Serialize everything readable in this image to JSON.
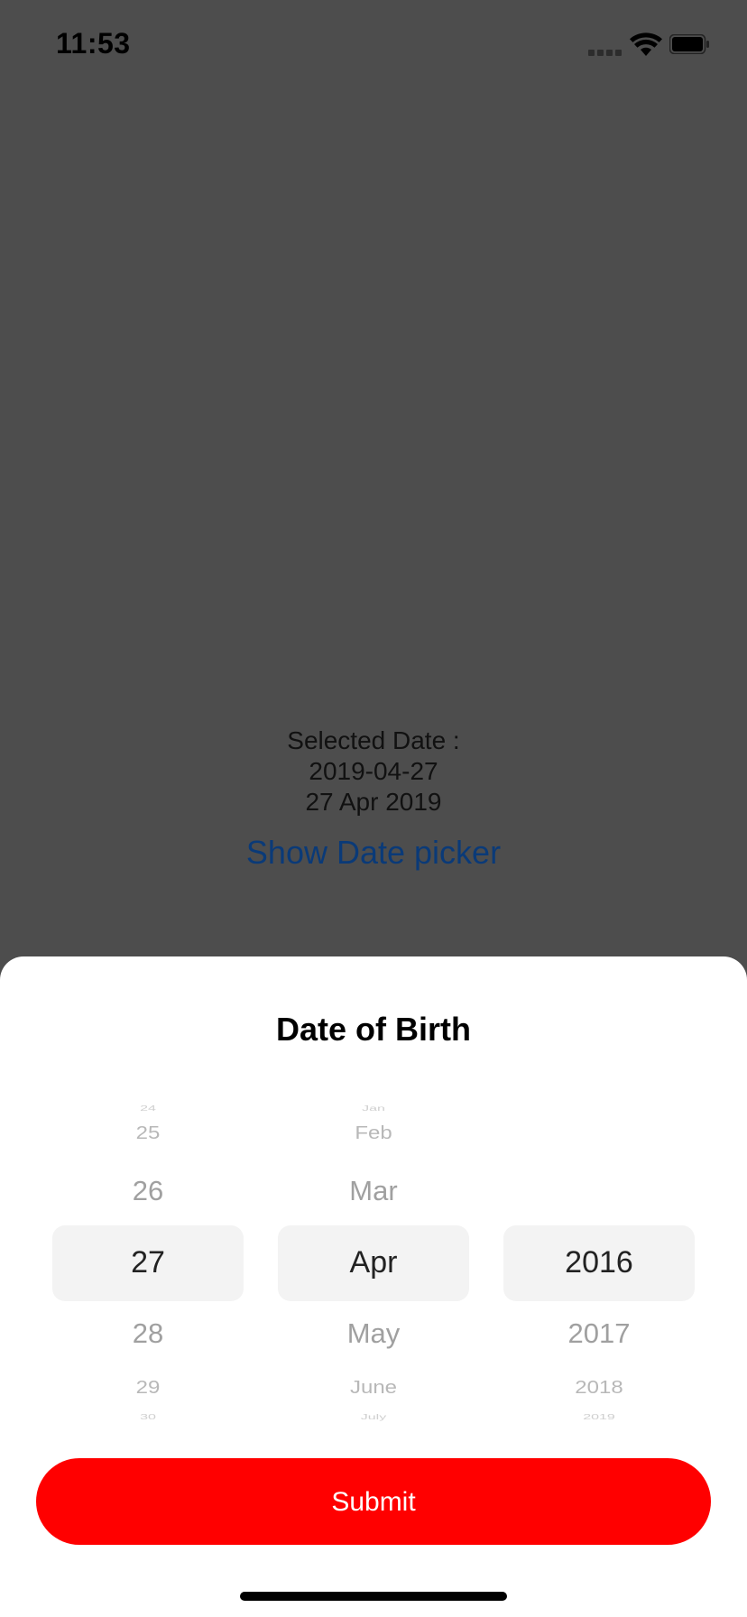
{
  "status_bar": {
    "time": "11:53"
  },
  "background": {
    "selected_label": "Selected Date :",
    "date_iso": "2019-04-27",
    "date_long": "27 Apr 2019",
    "show_picker_link": "Show Date picker"
  },
  "sheet": {
    "title": "Date of Birth",
    "picker": {
      "day": {
        "above": [
          "24",
          "25",
          "26"
        ],
        "selected": "27",
        "below": [
          "28",
          "29",
          "30"
        ]
      },
      "month": {
        "above": [
          "Jan",
          "Feb",
          "Mar"
        ],
        "selected": "Apr",
        "below": [
          "May",
          "June",
          "July"
        ]
      },
      "year": {
        "selected": "2016",
        "below": [
          "2017",
          "2018",
          "2019"
        ]
      }
    },
    "submit_label": "Submit"
  },
  "colors": {
    "overlay": "#4d4d4d",
    "submit": "#ff0000",
    "link": "#0a3a78"
  }
}
